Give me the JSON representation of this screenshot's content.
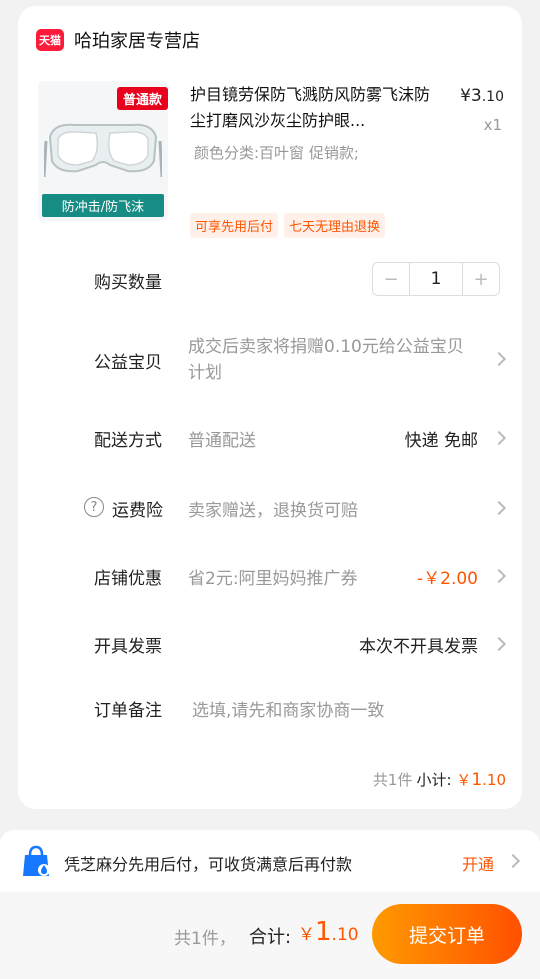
{
  "shop": {
    "logo_text": "天猫",
    "name": "哈珀家居专营店"
  },
  "product": {
    "badge_top": "普通款",
    "badge_bottom": "防冲击/防飞沫",
    "title": "护目镜劳保防飞溅防风防雾飞沫防尘打磨风沙灰尘防护眼...",
    "price_symbol": "¥",
    "price_int": "3",
    "price_dec": ".10",
    "qty": "x1",
    "sku": "颜色分类:百叶窗 促销款;",
    "tags": [
      "可享先用后付",
      "七天无理由退换"
    ]
  },
  "rows": {
    "quantity": {
      "label": "购买数量",
      "minus": "−",
      "value": "1",
      "plus": "+"
    },
    "charity": {
      "label": "公益宝贝",
      "value": "成交后卖家将捐赠0.10元给公益宝贝计划"
    },
    "delivery": {
      "label": "配送方式",
      "value": "普通配送",
      "right": "快递 免邮"
    },
    "insurance": {
      "icon": "?",
      "label": "运费险",
      "value": "卖家赠送，退换货可赔"
    },
    "discount": {
      "label": "店铺优惠",
      "value": "省2元:阿里妈妈推广券",
      "right": "-￥2.00"
    },
    "invoice": {
      "label": "开具发票",
      "right": "本次不开具发票"
    },
    "note": {
      "label": "订单备注",
      "placeholder": "选填,请先和商家协商一致"
    }
  },
  "subtotal": {
    "count": "共1件",
    "label": "小计:",
    "symbol": "￥",
    "int": "1",
    "dec": ".10"
  },
  "pay_later": {
    "text": "凭芝麻分先用后付，可收货满意后再付款",
    "action": "开通"
  },
  "footer": {
    "count": "共1件，",
    "total_label": "合计:",
    "symbol": "￥",
    "int": "1",
    "dec": ".10",
    "submit": "提交订单"
  },
  "colors": {
    "accent": "#ff5500",
    "tmall_red": "#ff1a3a",
    "badge_teal": "#178c84"
  }
}
